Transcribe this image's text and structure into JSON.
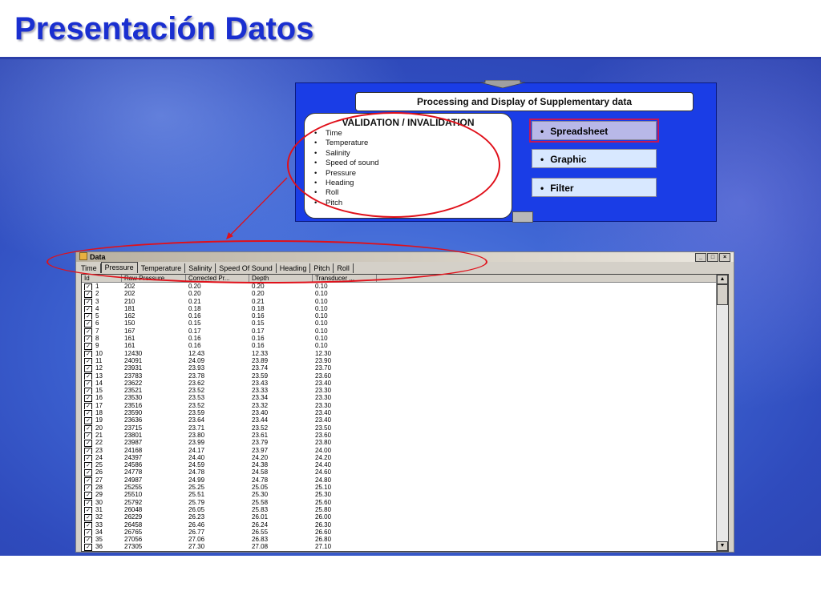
{
  "slide": {
    "title": "Presentación Datos"
  },
  "diagram": {
    "header": "Processing and Display of Supplementary data",
    "validation_title": "VALIDATION / INVALIDATION",
    "validation_items": [
      "Time",
      "Temperature",
      "Salinity",
      "Speed of sound",
      "Pressure",
      "Heading",
      "Roll",
      "Pitch"
    ],
    "options": [
      {
        "label": "Spreadsheet",
        "selected": true
      },
      {
        "label": "Graphic",
        "selected": false
      },
      {
        "label": "Filter",
        "selected": false
      }
    ]
  },
  "window": {
    "title": "Data",
    "controls": [
      "_",
      "□",
      "×"
    ],
    "tabs": [
      {
        "label": "Time",
        "active": false
      },
      {
        "label": "Pressure",
        "active": true
      },
      {
        "label": "Temperature",
        "active": false
      },
      {
        "label": "Salinity",
        "active": false
      },
      {
        "label": "Speed Of Sound",
        "active": false
      },
      {
        "label": "Heading",
        "active": false
      },
      {
        "label": "Pitch",
        "active": false
      },
      {
        "label": "Roll",
        "active": false
      }
    ],
    "columns": [
      "Id",
      "Raw Pressure",
      "Corrected Pr...",
      "Depth",
      "Transducer ..."
    ],
    "rows": [
      [
        "1",
        "202",
        "0.20",
        "0.20",
        "0.10"
      ],
      [
        "2",
        "202",
        "0.20",
        "0.20",
        "0.10"
      ],
      [
        "3",
        "210",
        "0.21",
        "0.21",
        "0.10"
      ],
      [
        "4",
        "181",
        "0.18",
        "0.18",
        "0.10"
      ],
      [
        "5",
        "162",
        "0.16",
        "0.16",
        "0.10"
      ],
      [
        "6",
        "150",
        "0.15",
        "0.15",
        "0.10"
      ],
      [
        "7",
        "167",
        "0.17",
        "0.17",
        "0.10"
      ],
      [
        "8",
        "161",
        "0.16",
        "0.16",
        "0.10"
      ],
      [
        "9",
        "161",
        "0.16",
        "0.16",
        "0.10"
      ],
      [
        "10",
        "12430",
        "12.43",
        "12.33",
        "12.30"
      ],
      [
        "11",
        "24091",
        "24.09",
        "23.89",
        "23.90"
      ],
      [
        "12",
        "23931",
        "23.93",
        "23.74",
        "23.70"
      ],
      [
        "13",
        "23783",
        "23.78",
        "23.59",
        "23.60"
      ],
      [
        "14",
        "23622",
        "23.62",
        "23.43",
        "23.40"
      ],
      [
        "15",
        "23521",
        "23.52",
        "23.33",
        "23.30"
      ],
      [
        "16",
        "23530",
        "23.53",
        "23.34",
        "23.30"
      ],
      [
        "17",
        "23516",
        "23.52",
        "23.32",
        "23.30"
      ],
      [
        "18",
        "23590",
        "23.59",
        "23.40",
        "23.40"
      ],
      [
        "19",
        "23636",
        "23.64",
        "23.44",
        "23.40"
      ],
      [
        "20",
        "23715",
        "23.71",
        "23.52",
        "23.50"
      ],
      [
        "21",
        "23801",
        "23.80",
        "23.61",
        "23.60"
      ],
      [
        "22",
        "23987",
        "23.99",
        "23.79",
        "23.80"
      ],
      [
        "23",
        "24168",
        "24.17",
        "23.97",
        "24.00"
      ],
      [
        "24",
        "24397",
        "24.40",
        "24.20",
        "24.20"
      ],
      [
        "25",
        "24586",
        "24.59",
        "24.38",
        "24.40"
      ],
      [
        "26",
        "24778",
        "24.78",
        "24.58",
        "24.60"
      ],
      [
        "27",
        "24987",
        "24.99",
        "24.78",
        "24.80"
      ],
      [
        "28",
        "25255",
        "25.25",
        "25.05",
        "25.10"
      ],
      [
        "29",
        "25510",
        "25.51",
        "25.30",
        "25.30"
      ],
      [
        "30",
        "25792",
        "25.79",
        "25.58",
        "25.60"
      ],
      [
        "31",
        "26048",
        "26.05",
        "25.83",
        "25.80"
      ],
      [
        "32",
        "26229",
        "26.23",
        "26.01",
        "26.00"
      ],
      [
        "33",
        "26458",
        "26.46",
        "26.24",
        "26.30"
      ],
      [
        "34",
        "26765",
        "26.77",
        "26.55",
        "26.60"
      ],
      [
        "35",
        "27056",
        "27.06",
        "26.83",
        "26.80"
      ],
      [
        "36",
        "27305",
        "27.30",
        "27.08",
        "27.10"
      ]
    ]
  },
  "colors": {
    "title": "#1a2fd0",
    "annotation": "#e0101a",
    "diagram_bg": "#1a3de6"
  }
}
